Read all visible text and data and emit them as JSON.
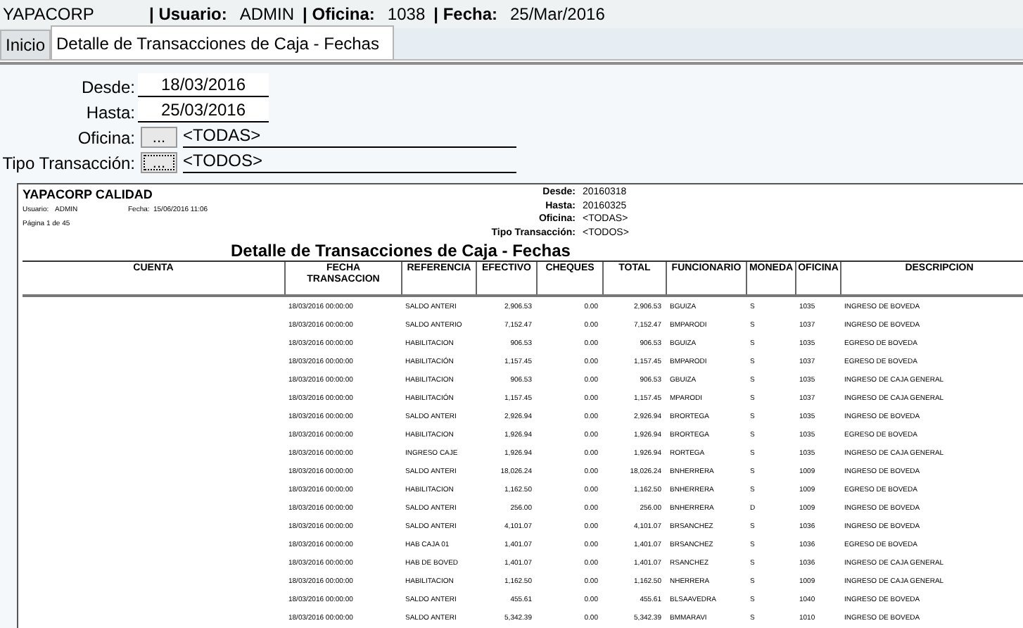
{
  "header": {
    "app_name": "YAPACORP",
    "fields": [
      {
        "label": "| Usuario:",
        "value": "ADMIN"
      },
      {
        "label": "| Oficina:",
        "value": "1038"
      },
      {
        "label": "| Fecha:",
        "value": "25/Mar/2016"
      }
    ]
  },
  "tabs": [
    {
      "label": "Inicio",
      "selected": false
    },
    {
      "label": "Detalle de Transacciones de Caja - Fechas",
      "selected": true
    }
  ],
  "filters": [
    {
      "kind": "date",
      "label": "Desde:",
      "value": "18/03/2016"
    },
    {
      "kind": "date",
      "label": "Hasta:",
      "value": "25/03/2016"
    },
    {
      "kind": "lookup",
      "label": "Oficina:",
      "button": "...",
      "focused": false,
      "value": "<TODAS>"
    },
    {
      "kind": "lookup",
      "label": "Tipo Transacción:",
      "button": "...",
      "focused": true,
      "value": "<TODOS>"
    }
  ],
  "report": {
    "company": "YAPACORP CALIDAD",
    "user_label": "Usuario:",
    "user": "ADMIN",
    "date_label": "Fecha:",
    "date": "15/06/2016 11:06",
    "page": "Página 1 de 45",
    "params": [
      {
        "label": "Desde:",
        "value": "20160318"
      },
      {
        "label": "Hasta:",
        "value": "20160325"
      },
      {
        "label": "Oficina:",
        "value": "<TODAS>"
      },
      {
        "label": "Tipo Transacción:",
        "value": "<TODOS>"
      }
    ],
    "title": "Detalle de Transacciones de Caja - Fechas",
    "columns": [
      "CUENTA",
      "FECHA TRANSACCION",
      "REFERENCIA",
      "EFECTIVO",
      "CHEQUES",
      "TOTAL",
      "FUNCIONARIO",
      "MONEDA",
      "OFICINA",
      "DESCRIPCION"
    ],
    "rows": [
      [
        "",
        "18/03/2016 00:00:00",
        "SALDO ANTERI",
        "2,906.53",
        "0.00",
        "2,906.53",
        "BGUIZA",
        "S",
        "1035",
        "INGRESO DE BOVEDA"
      ],
      [
        "",
        "18/03/2016 00:00:00",
        "SALDO ANTERIO",
        "7,152.47",
        "0.00",
        "7,152.47",
        "BMPARODI",
        "S",
        "1037",
        "INGRESO DE BOVEDA"
      ],
      [
        "",
        "18/03/2016 00:00:00",
        "HABILITACION",
        "906.53",
        "0.00",
        "906.53",
        "BGUIZA",
        "S",
        "1035",
        "EGRESO DE BOVEDA"
      ],
      [
        "",
        "18/03/2016 00:00:00",
        "HABILITACIÓN",
        "1,157.45",
        "0.00",
        "1,157.45",
        "BMPARODI",
        "S",
        "1037",
        "EGRESO DE BOVEDA"
      ],
      [
        "",
        "18/03/2016 00:00:00",
        "HABILITACION",
        "906.53",
        "0.00",
        "906.53",
        "GBUIZA",
        "S",
        "1035",
        "INGRESO DE CAJA GENERAL"
      ],
      [
        "",
        "18/03/2016 00:00:00",
        "HABILITACIÓN",
        "1,157.45",
        "0.00",
        "1,157.45",
        "MPARODI",
        "S",
        "1037",
        "INGRESO DE CAJA GENERAL"
      ],
      [
        "",
        "18/03/2016 00:00:00",
        "SALDO ANTERI",
        "2,926.94",
        "0.00",
        "2,926.94",
        "BRORTEGA",
        "S",
        "1035",
        "INGRESO DE BOVEDA"
      ],
      [
        "",
        "18/03/2016 00:00:00",
        "HABILITACION",
        "1,926.94",
        "0.00",
        "1,926.94",
        "BRORTEGA",
        "S",
        "1035",
        "EGRESO DE BOVEDA"
      ],
      [
        "",
        "18/03/2016 00:00:00",
        "INGRESO CAJE",
        "1,926.94",
        "0.00",
        "1,926.94",
        "RORTEGA",
        "S",
        "1035",
        "INGRESO DE CAJA GENERAL"
      ],
      [
        "",
        "18/03/2016 00:00:00",
        "SALDO ANTERI",
        "18,026.24",
        "0.00",
        "18,026.24",
        "BNHERRERA",
        "S",
        "1009",
        "INGRESO DE BOVEDA"
      ],
      [
        "",
        "18/03/2016 00:00:00",
        "HABILITACION",
        "1,162.50",
        "0.00",
        "1,162.50",
        "BNHERRERA",
        "S",
        "1009",
        "EGRESO DE BOVEDA"
      ],
      [
        "",
        "18/03/2016 00:00:00",
        "SALDO ANTERI",
        "256.00",
        "0.00",
        "256.00",
        "BNHERRERA",
        "D",
        "1009",
        "INGRESO DE BOVEDA"
      ],
      [
        "",
        "18/03/2016 00:00:00",
        "SALDO ANTERI",
        "4,101.07",
        "0.00",
        "4,101.07",
        "BRSANCHEZ",
        "S",
        "1036",
        "INGRESO DE BOVEDA"
      ],
      [
        "",
        "18/03/2016 00:00:00",
        "HAB CAJA 01",
        "1,401.07",
        "0.00",
        "1,401.07",
        "BRSANCHEZ",
        "S",
        "1036",
        "EGRESO DE BOVEDA"
      ],
      [
        "",
        "18/03/2016 00:00:00",
        "HAB DE BOVED",
        "1,401.07",
        "0.00",
        "1,401.07",
        "RSANCHEZ",
        "S",
        "1036",
        "INGRESO DE CAJA GENERAL"
      ],
      [
        "",
        "18/03/2016 00:00:00",
        "HABILITACION",
        "1,162.50",
        "0.00",
        "1,162.50",
        "NHERRERA",
        "S",
        "1009",
        "INGRESO DE CAJA GENERAL"
      ],
      [
        "",
        "18/03/2016 00:00:00",
        "SALDO ANTERI",
        "455.61",
        "0.00",
        "455.61",
        "BLSAAVEDRA",
        "S",
        "1040",
        "INGRESO DE BOVEDA"
      ],
      [
        "",
        "18/03/2016 00:00:00",
        "SALDO ANTERI",
        "5,342.39",
        "0.00",
        "5,342.39",
        "BMMARAVI",
        "S",
        "1010",
        "INGRESO DE BOVEDA"
      ]
    ]
  }
}
